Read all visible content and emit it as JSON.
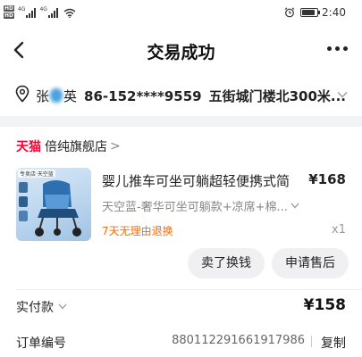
{
  "status_bar": {
    "hd1": "HD",
    "hd2": "HD",
    "net1": "4G",
    "net2": "4G",
    "time": "2:40",
    "battery_level": 0.9
  },
  "header": {
    "title": "交易成功"
  },
  "address": {
    "name_first": "张",
    "name_last": "英",
    "phone": "86-152****9559",
    "detail": "五街城门楼北300米..."
  },
  "shop": {
    "badge": "天猫",
    "name": "倍纯旗舰店",
    "arrow": ">"
  },
  "product": {
    "image_tag": "专卖店·天空蓝",
    "title": "婴儿推车可坐可躺超轻便携式简",
    "price": "¥168",
    "sku": "天空蓝-奢华可坐可躺款+凉席+棉...",
    "return_policy": "7天无理由退换",
    "quantity": "x1"
  },
  "actions": {
    "sell_label": "卖了换钱",
    "aftersale_label": "申请售后"
  },
  "payment": {
    "label": "实付款",
    "amount": "¥158"
  },
  "order": {
    "label": "订单编号",
    "number": "880112291661917986",
    "copy_label": "复制"
  },
  "colors": {
    "tmall_red": "#ff0036",
    "return_orange": "#ff6a00"
  },
  "icons": [
    "back-icon",
    "more-icon",
    "location-pin-icon",
    "chevron-down-icon",
    "wifi-icon",
    "alarm-icon",
    "battery-icon"
  ]
}
